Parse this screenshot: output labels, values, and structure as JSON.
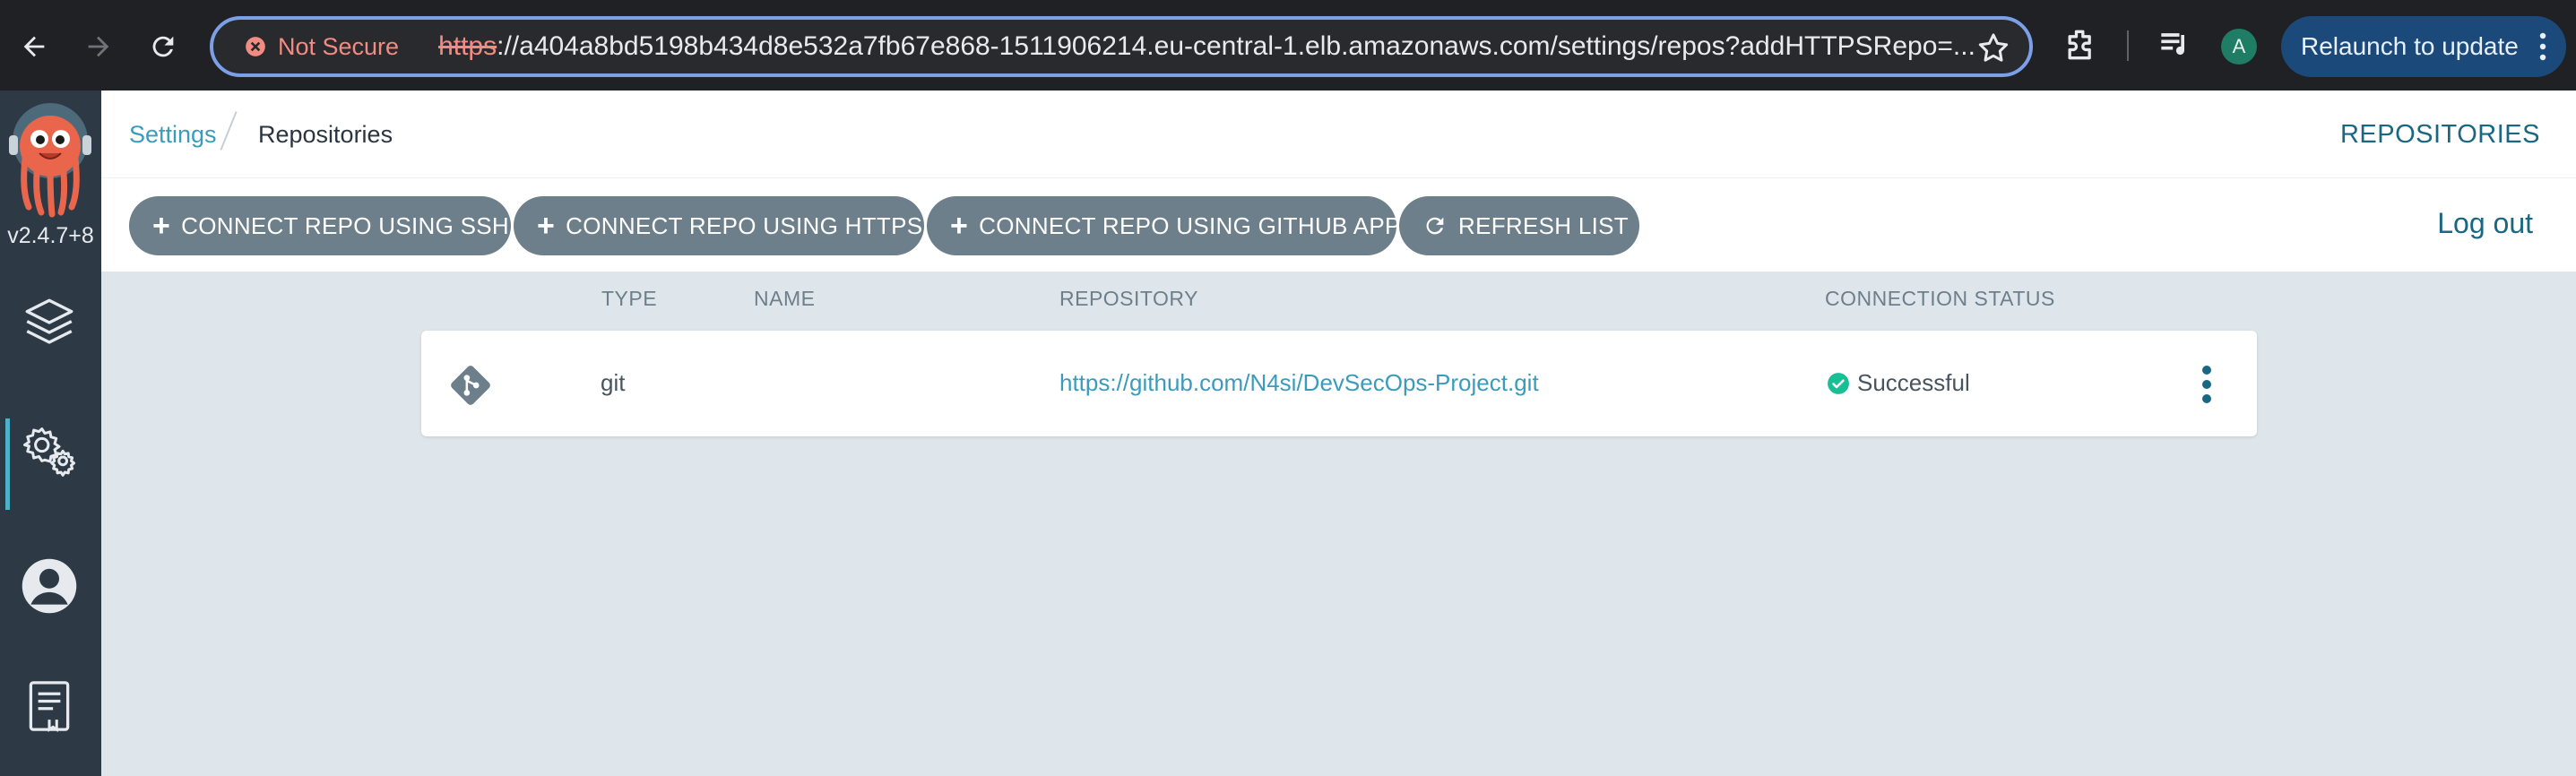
{
  "browser": {
    "security_label": "Not Secure",
    "url_scheme": "https",
    "url_rest": "://a404a8bd5198b434d8e532a7fb67e868-1511906214.eu-central-1.elb.amazonaws.com/settings/repos?addHTTPSRepo=...",
    "profile_initial": "A",
    "relaunch_label": "Relaunch to update"
  },
  "sidebar": {
    "version": "v2.4.7+8",
    "items": [
      {
        "name": "applications",
        "icon": "layers-icon"
      },
      {
        "name": "settings",
        "icon": "gear-icon",
        "active": true
      },
      {
        "name": "user-info",
        "icon": "user-icon"
      },
      {
        "name": "docs",
        "icon": "docs-icon"
      }
    ]
  },
  "topbar": {
    "breadcrumb_parent": "Settings",
    "breadcrumb_current": "Repositories",
    "page_title": "REPOSITORIES"
  },
  "toolbar": {
    "connect_ssh": "CONNECT REPO USING SSH",
    "connect_https": "CONNECT REPO USING HTTPS",
    "connect_github_app": "CONNECT REPO USING GITHUB APP",
    "refresh": "REFRESH LIST",
    "logout": "Log out"
  },
  "table": {
    "columns": {
      "type": "TYPE",
      "name": "NAME",
      "repository": "REPOSITORY",
      "connection_status": "CONNECTION STATUS"
    },
    "rows": [
      {
        "type": "git",
        "name": "",
        "repository": "https://github.com/N4si/DevSecOps-Project.git",
        "connection_status": "Successful"
      }
    ]
  },
  "colors": {
    "accent": "#3b9bbd",
    "button_bg": "#6d7f8b",
    "sidebar_bg": "#2d3a45",
    "success": "#18be94"
  }
}
